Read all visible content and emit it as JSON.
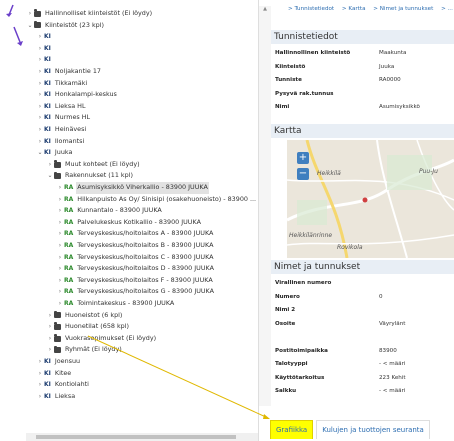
{
  "tree": {
    "items": [
      {
        "label": "Hallinnolliset kiinteistöt (Ei löydy)",
        "icon": "folder-icon",
        "chev": "›",
        "indent": 0
      },
      {
        "label": "Kiinteistöt (23 kpl)",
        "icon": "folder-icon",
        "chev": "⌄",
        "indent": 0
      },
      {
        "label": "",
        "icon": "KI",
        "chev": "›",
        "indent": 1
      },
      {
        "label": "",
        "icon": "KI",
        "chev": "›",
        "indent": 1
      },
      {
        "label": "",
        "icon": "KI",
        "chev": "›",
        "indent": 1
      },
      {
        "label": "Noljakantie 17",
        "icon": "KI",
        "chev": "›",
        "indent": 1
      },
      {
        "label": "Tikkamäki",
        "icon": "KI",
        "chev": "›",
        "indent": 1
      },
      {
        "label": "Honkalampi-keskus",
        "icon": "KI",
        "chev": "›",
        "indent": 1
      },
      {
        "label": "Lieksa HL",
        "icon": "KI",
        "chev": "›",
        "indent": 1
      },
      {
        "label": "Nurmes HL",
        "icon": "KI",
        "chev": "›",
        "indent": 1
      },
      {
        "label": "Heinävesi",
        "icon": "KI",
        "chev": "›",
        "indent": 1
      },
      {
        "label": "Ilomantsi",
        "icon": "KI",
        "chev": "›",
        "indent": 1
      },
      {
        "label": "Juuka",
        "icon": "KI",
        "chev": "⌄",
        "indent": 1
      },
      {
        "label": "Muut kohteet (Ei löydy)",
        "icon": "folder-icon",
        "chev": "›",
        "indent": 2
      },
      {
        "label": "Rakennukset (11 kpl)",
        "icon": "folder-icon",
        "chev": "⌄",
        "indent": 2
      },
      {
        "label": "Asumisyksikkö Viherkallio - 83900 JUUKA",
        "icon": "RA",
        "chev": "›",
        "indent": 3,
        "selected": true
      },
      {
        "label": "Hilkanpuisto As Oy/ Sinisipi (osakehuoneisto) - 83900 ...",
        "icon": "RA",
        "chev": "›",
        "indent": 3
      },
      {
        "label": "Kunnantalo - 83900 JUUKA",
        "icon": "RA",
        "chev": "›",
        "indent": 3
      },
      {
        "label": "Palvelukeskus Kotikallio - 83900 JUUKA",
        "icon": "RA",
        "chev": "›",
        "indent": 3
      },
      {
        "label": "Terveyskeskus/hoitolaitos A - 83900 JUUKA",
        "icon": "RA",
        "chev": "›",
        "indent": 3
      },
      {
        "label": "Terveyskeskus/hoitolaitos B - 83900 JUUKA",
        "icon": "RA",
        "chev": "›",
        "indent": 3
      },
      {
        "label": "Terveyskeskus/hoitolaitos C - 83900 JUUKA",
        "icon": "RA",
        "chev": "›",
        "indent": 3
      },
      {
        "label": "Terveyskeskus/hoitolaitos D - 83900 JUUKA",
        "icon": "RA",
        "chev": "›",
        "indent": 3
      },
      {
        "label": "Terveyskeskus/hoitolaitos F - 83900 JUUKA",
        "icon": "RA",
        "chev": "›",
        "indent": 3
      },
      {
        "label": "Terveyskeskus/hoitolaitos G - 83900 JUUKA",
        "icon": "RA",
        "chev": "›",
        "indent": 3
      },
      {
        "label": "Toimintakeskus - 83900 JUUKA",
        "icon": "RA",
        "chev": "›",
        "indent": 3
      },
      {
        "label": "Huoneistot (6 kpl)",
        "icon": "folder-icon",
        "chev": "›",
        "indent": 2
      },
      {
        "label": "Huonetilat (658 kpl)",
        "icon": "folder-icon",
        "chev": "›",
        "indent": 2
      },
      {
        "label": "Vuokrasopimukset (Ei löydy)",
        "icon": "folder-icon",
        "chev": "›",
        "indent": 2
      },
      {
        "label": "Ryhmät (Ei löydy)",
        "icon": "folder-icon",
        "chev": "›",
        "indent": 2
      },
      {
        "label": "Joensuu",
        "icon": "KI",
        "chev": "›",
        "indent": 1
      },
      {
        "label": "Kitee",
        "icon": "KI",
        "chev": "›",
        "indent": 1
      },
      {
        "label": "Kontiolahti",
        "icon": "KI",
        "chev": "›",
        "indent": 1
      },
      {
        "label": "Lieksa",
        "icon": "KI",
        "chev": "›",
        "indent": 1
      }
    ]
  },
  "breadcrumb": [
    "> Tunnistetiedot",
    "> Kartta",
    "> Nimet ja tunnukset",
    "> ..."
  ],
  "tunnistetiedot": {
    "title": "Tunnistetiedot",
    "rows": [
      {
        "label": "Hallinnollinen kiinteistö",
        "value": "Maakunta"
      },
      {
        "label": "Kiinteistö",
        "value": "Juuka"
      },
      {
        "label": "Tunniste",
        "value": "RA0000"
      },
      {
        "label": "Pysyvä rak.tunnus",
        "value": ""
      },
      {
        "label": "Nimi",
        "value": "Asumisyksikkö"
      }
    ]
  },
  "kartta": {
    "title": "Kartta",
    "zoom_in": "+",
    "zoom_out": "−",
    "labels": [
      "Heikkilä",
      "Puu-Ju",
      "Heikkilänrinne",
      "Rovikola"
    ]
  },
  "nimet": {
    "title": "Nimet ja tunnukset",
    "rows": [
      {
        "label": "Virallinen numero",
        "value": ""
      },
      {
        "label": "Numero",
        "value": "0"
      },
      {
        "label": "Nimi 2",
        "value": ""
      },
      {
        "label": "Osoite",
        "value": "Väyrylänt"
      },
      {
        "label": "",
        "value": ""
      },
      {
        "label": "Postitoimipaikka",
        "value": "83900"
      },
      {
        "label": "Talotyyppi",
        "value": "- < määri"
      },
      {
        "label": "Käyttötarkoitus",
        "value": "223 Kehit"
      },
      {
        "label": "Salkku",
        "value": "- < määri"
      }
    ]
  },
  "tabs": {
    "grafiikka": "Grafiikka",
    "kulujen": "Kulujen ja tuottojen seuranta"
  },
  "colors": {
    "highlight": "#ffff00",
    "annotation_arrow": "#6a3fc9",
    "annotation_line": "#e0b800",
    "link": "#2b6cb0",
    "tag_ki": "#1b3b6f",
    "tag_ra": "#2e8b2e"
  }
}
